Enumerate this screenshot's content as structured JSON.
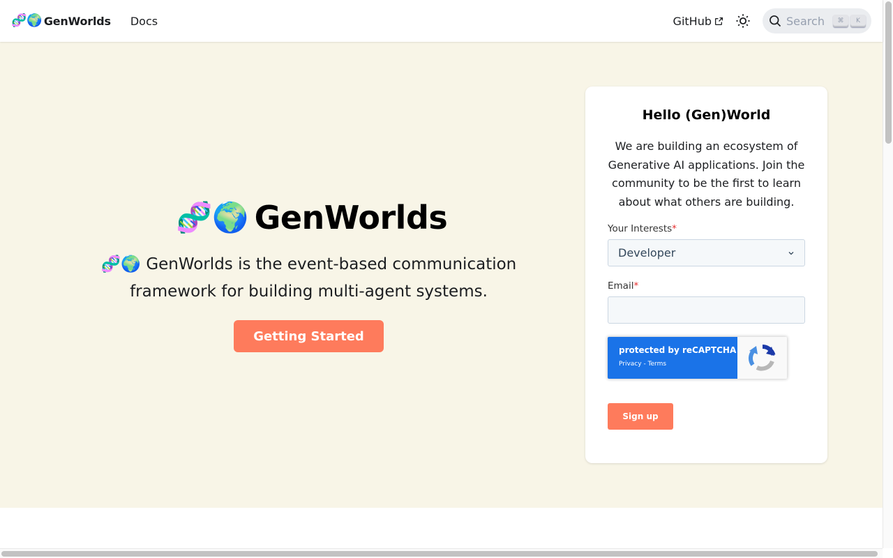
{
  "navbar": {
    "brand_emoji": "🧬🌍",
    "brand_name": "GenWorlds",
    "docs_label": "Docs",
    "github_label": "GitHub",
    "search_placeholder": "Search",
    "search_shortcut": [
      "⌘",
      "K"
    ]
  },
  "hero": {
    "title_emoji": "🧬🌍",
    "title": "GenWorlds",
    "subtitle": "🧬🌍 GenWorlds is the event-based communication framework for building multi-agent systems.",
    "cta_label": "Getting Started",
    "background": "#f8f5e7",
    "accent": "#fe7b5c"
  },
  "signup": {
    "title": "Hello (Gen)World",
    "description": "We are building an ecosystem of Generative AI applications. Join the community to be the first to learn about what others are building.",
    "interests_label": "Your Interests",
    "interests_value": "Developer",
    "email_label": "Email",
    "email_value": "",
    "required_mark": "*",
    "recaptcha_text": "protected by reCAPTCHA",
    "recaptcha_links": "Privacy - Terms",
    "submit_label": "Sign up"
  }
}
